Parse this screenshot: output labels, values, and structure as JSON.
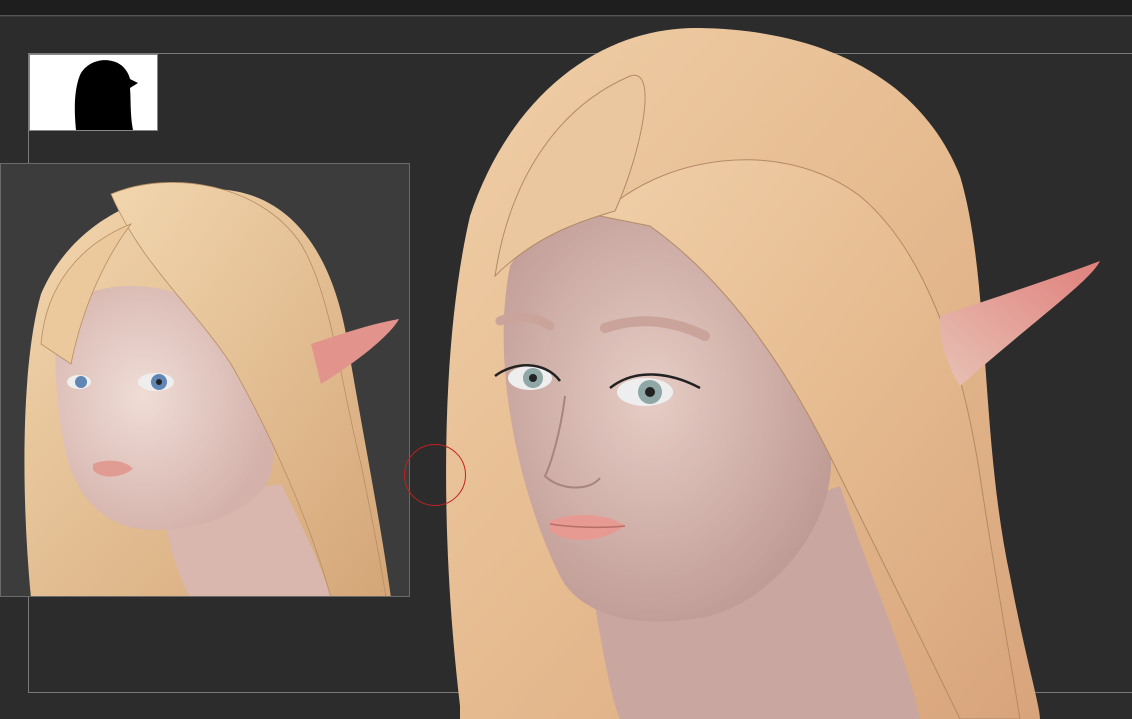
{
  "app": {
    "window_title": "",
    "colors": {
      "background": "#2c2c2c",
      "toolbar": "#1e1e1e",
      "frame": "#7a7a7a",
      "hair": "#e3b88f",
      "skin": "#d9b8b0",
      "ear_tip": "#e08a86",
      "brush_cursor": "#c2201f"
    }
  },
  "navigator": {
    "icon": "head-silhouette-icon"
  },
  "reference": {
    "icon": "rendered-elf-reference-image"
  },
  "viewport": {
    "icon": "sculpted-elf-head-model",
    "cursor_icon": "brush-cursor-circle-icon"
  }
}
